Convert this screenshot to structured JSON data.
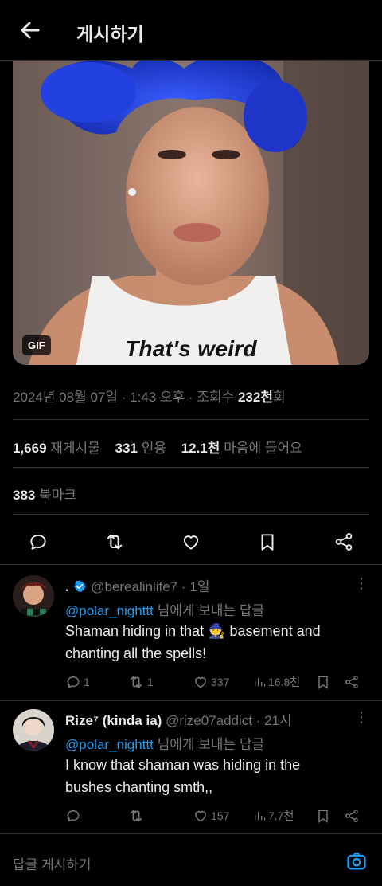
{
  "header": {
    "title": "게시하기"
  },
  "media": {
    "badge": "GIF",
    "caption": "That's weird"
  },
  "post": {
    "timestamp": "2024년 08월 07일 · 1:43 오후 · 조회수 ",
    "views": "232천",
    "views_suffix": "회",
    "reposts_count": "1,669",
    "reposts_label": "재게시물",
    "quotes_count": "331",
    "quotes_label": "인용",
    "likes_count": "12.1천",
    "likes_label": "마음에 들어요",
    "bookmarks_count": "383",
    "bookmarks_label": "북마크"
  },
  "replies": [
    {
      "name": ".",
      "handle": "@berealinlife7",
      "time": "· 1일",
      "verified": true,
      "mention": "@polar_nighttt",
      "replying_label": "님에게 보내는 답글",
      "text_line1": "Shaman hiding in that 🧙 basement and",
      "text_line2": "chanting all the spells!",
      "reply_count": "1",
      "repost_count": "1",
      "like_count": "337",
      "view_count": "16.8천"
    },
    {
      "name": "Rize⁷ (kinda ia)",
      "handle": "@rize07addict",
      "time": "· 21시",
      "verified": false,
      "mention": "@polar_nighttt",
      "replying_label": "님에게 보내는 답글",
      "text_line1": "I know that shaman was hiding in the",
      "text_line2": "bushes chanting smth,,",
      "reply_count": "",
      "repost_count": "",
      "like_count": "157",
      "view_count": "7.7천"
    }
  ],
  "composer": {
    "placeholder": "답글 게시하기"
  },
  "colors": {
    "background": "#000000",
    "text": "#e7e9ea",
    "muted": "#71767b",
    "accent": "#1d9bf0",
    "divider": "#2f3336"
  }
}
